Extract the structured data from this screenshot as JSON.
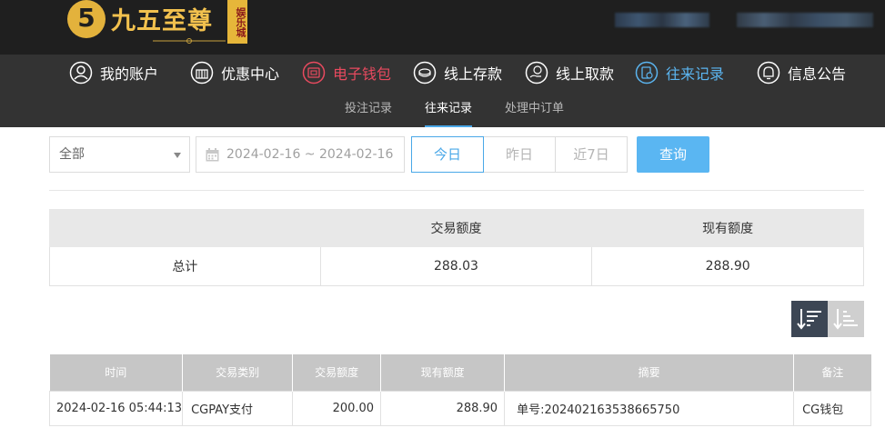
{
  "header": {
    "logo_number": "5",
    "logo_text": "九五至尊",
    "logo_sub": "娱乐城"
  },
  "nav": {
    "items": [
      {
        "label": "我的账户",
        "icon": "user-icon"
      },
      {
        "label": "优惠中心",
        "icon": "gift-icon"
      },
      {
        "label": "电子钱包",
        "icon": "wallet-icon"
      },
      {
        "label": "线上存款",
        "icon": "deposit-icon"
      },
      {
        "label": "线上取款",
        "icon": "withdraw-icon"
      },
      {
        "label": "往来记录",
        "icon": "records-icon"
      },
      {
        "label": "信息公告",
        "icon": "bell-icon"
      }
    ],
    "colors": {
      "default": "#ffffff",
      "wallet": "#e84a5f",
      "active": "#5bb5f0"
    }
  },
  "subnav": {
    "tabs": [
      {
        "label": "投注记录"
      },
      {
        "label": "往来记录"
      },
      {
        "label": "处理中订单"
      }
    ],
    "active": "往来记录"
  },
  "filters": {
    "type_select": "全部",
    "date_range": "2024-02-16 ~ 2024-02-16",
    "quick_ranges": [
      "今日",
      "昨日",
      "近7日"
    ],
    "active_range": "今日",
    "query_button": "查询"
  },
  "summary": {
    "headers": [
      "",
      "交易额度",
      "现有额度"
    ],
    "total_label": "总计",
    "transaction_amount": "288.03",
    "current_amount": "288.90"
  },
  "records": {
    "columns": [
      "时间",
      "交易类别",
      "交易额度",
      "现有额度",
      "摘要",
      "备注"
    ],
    "rows": [
      {
        "time": "2024-02-16 05:44:13",
        "type": "CGPAY支付",
        "amount": "200.00",
        "balance": "288.90",
        "summary": "单号:202402163538665750",
        "remark": "CG钱包"
      }
    ]
  },
  "colors": {
    "accent": "#4aa8e8",
    "button": "#5ab6f2",
    "header_bg": "#1f1f1f",
    "nav_bg": "#333333",
    "logo_gold": "#f2c14e"
  }
}
